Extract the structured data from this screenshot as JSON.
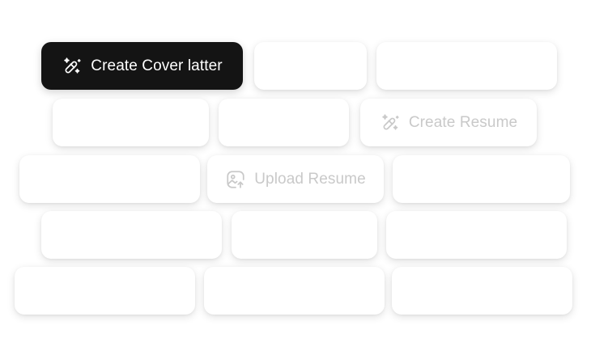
{
  "buttons": {
    "create_cover_letter": {
      "label": "Create Cover latter",
      "icon": "magic-wand-icon"
    },
    "create_resume": {
      "label": "Create Resume",
      "icon": "magic-wand-icon"
    },
    "upload_resume": {
      "label": "Upload Resume",
      "icon": "image-upload-icon"
    }
  },
  "colors": {
    "primary_button_bg": "#141414",
    "primary_button_text": "#ffffff",
    "muted_text": "#c9c9c9",
    "tile_bg": "#ffffff"
  }
}
